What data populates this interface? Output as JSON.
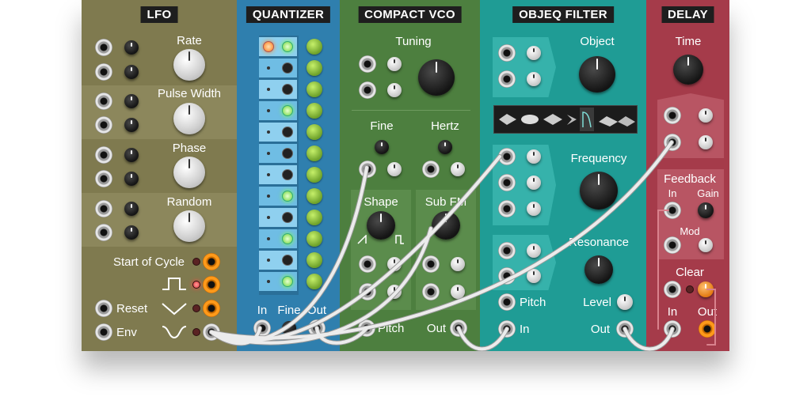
{
  "modules": {
    "lfo": {
      "title": "LFO",
      "rate": "Rate",
      "pulse_width": "Pulse Width",
      "phase": "Phase",
      "random": "Random",
      "start_of_cycle": "Start of Cycle",
      "reset": "Reset",
      "env": "Env"
    },
    "quantizer": {
      "title": "QUANTIZER",
      "in": "In",
      "fine": "Fine",
      "out": "Out"
    },
    "vco": {
      "title": "COMPACT VCO",
      "tuning": "Tuning",
      "fine": "Fine",
      "hertz": "Hertz",
      "shape": "Shape",
      "sub_fm": "Sub FM",
      "pitch": "Pitch",
      "out": "Out"
    },
    "filter": {
      "title": "OBJEQ FILTER",
      "object": "Object",
      "frequency": "Frequency",
      "resonance": "Resonance",
      "pitch": "Pitch",
      "level": "Level",
      "in": "In",
      "out": "Out"
    },
    "delay": {
      "title": "DELAY",
      "time": "Time",
      "feedback": "Feedback",
      "fb_in": "In",
      "gain": "Gain",
      "mod": "Mod",
      "clear": "Clear",
      "in": "In",
      "out": "Out"
    }
  },
  "colors": {
    "lfo": "#7f7a4f",
    "quantizer": "#2f7fae",
    "vco": "#4d7f3f",
    "filter": "#1f9c95",
    "delay": "#a53b4a",
    "cable": "#e8e8e8"
  }
}
